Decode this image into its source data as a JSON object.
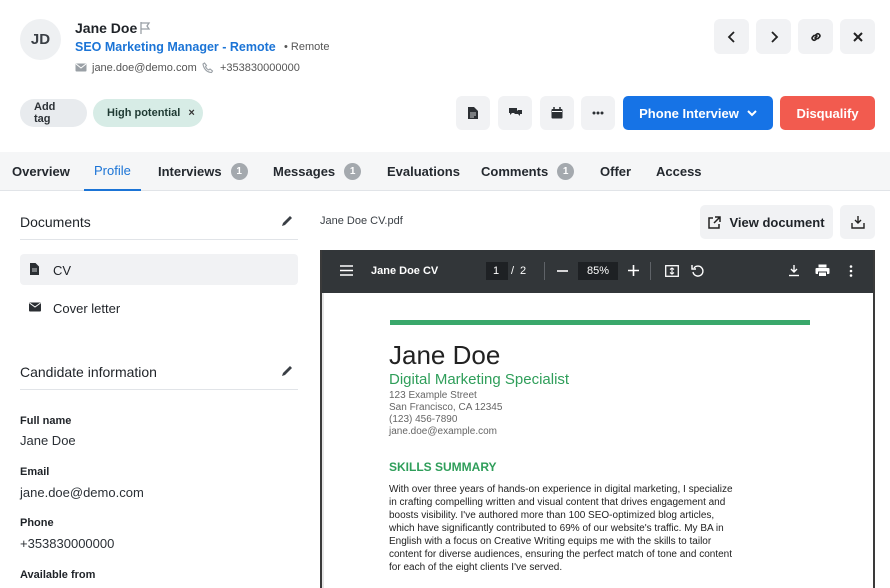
{
  "candidate": {
    "initials": "JD",
    "name": "Jane Doe",
    "job_title": "SEO Marketing Manager - Remote",
    "location": "Remote",
    "email": "jane.doe@demo.com",
    "phone": "+353830000000"
  },
  "tags": {
    "add_label": "Add tag",
    "items": [
      {
        "label": "High potential",
        "remove": "×"
      }
    ]
  },
  "actions": {
    "stage_label": "Phone Interview",
    "disqualify_label": "Disqualify"
  },
  "tabs": [
    {
      "label": "Overview"
    },
    {
      "label": "Profile"
    },
    {
      "label": "Interviews",
      "badge": "1"
    },
    {
      "label": "Messages",
      "badge": "1"
    },
    {
      "label": "Evaluations"
    },
    {
      "label": "Comments",
      "badge": "1"
    },
    {
      "label": "Offer"
    },
    {
      "label": "Access"
    }
  ],
  "documents": {
    "title": "Documents",
    "items": [
      {
        "label": "CV"
      },
      {
        "label": "Cover letter"
      }
    ]
  },
  "candidate_info": {
    "title": "Candidate information",
    "fields": [
      {
        "label": "Full name",
        "value": "Jane Doe"
      },
      {
        "label": "Email",
        "value": "jane.doe@demo.com"
      },
      {
        "label": "Phone",
        "value": "+353830000000"
      },
      {
        "label": "Available from",
        "value": ""
      }
    ]
  },
  "viewer": {
    "file_name": "Jane Doe CV.pdf",
    "view_label": "View document",
    "doc_title": "Jane Doe CV",
    "page_current": "1",
    "page_sep": "/",
    "page_total": "2",
    "zoom": "85%"
  },
  "cv": {
    "name": "Jane Doe",
    "role": "Digital Marketing Specialist",
    "address1": "123 Example Street",
    "address2": "San Francisco, CA 12345",
    "phone": "(123) 456-7890",
    "email": "jane.doe@example.com",
    "skills_heading": "SKILLS SUMMARY",
    "skills_lines": [
      "With over three years of hands-on experience in digital marketing, I specialize",
      "in crafting compelling written and visual content that drives engagement and",
      "boosts visibility. I've authored more than 100 SEO-optimized blog articles,",
      "which have significantly contributed to 69% of our website's traffic. My BA in",
      "English with a focus on Creative Writing equips me with the skills to tailor",
      "content for diverse audiences, ensuring the perfect match of tone and content",
      "for each of the eight clients I've served."
    ],
    "accent": "#3aa86b"
  },
  "colors": {
    "primary": "#1673e6",
    "danger": "#f25b4f",
    "link": "#1b74d6",
    "tag_bg": "#d7ece6"
  }
}
